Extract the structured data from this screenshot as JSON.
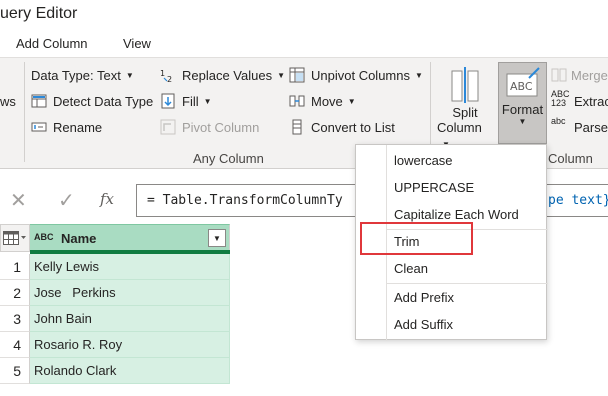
{
  "window": {
    "title": "uery Editor"
  },
  "ribbon_tabs": [
    "Add Column",
    "View"
  ],
  "ribbon": {
    "left_cut_label": "ws",
    "data_type": "Data Type: Text",
    "detect_data_type": "Detect Data Type",
    "rename": "Rename",
    "replace_values": "Replace Values",
    "fill": "Fill",
    "pivot_column": "Pivot Column",
    "unpivot_columns": "Unpivot Columns",
    "move": "Move",
    "convert_to_list": "Convert to List",
    "group_any_column": "Any Column",
    "split_column": "Split",
    "split_column_2": "Column",
    "format": "Format",
    "merge": "Merge",
    "extract": "Extrac",
    "parse": "Parse",
    "group_text_column": "Column",
    "format_icon_text": "ABC",
    "extract_icon_text": "ABC",
    "extract_icon_num": "123",
    "parse_icon_text": "abc"
  },
  "formula_bar": {
    "cancel_glyph": "✕",
    "confirm_glyph": "✓",
    "fx_label": "fx",
    "formula": "= Table.TransformColumnTy",
    "formula_tail": "pe text}"
  },
  "grid": {
    "type_icon": "ABC",
    "column_header": "Name",
    "rows": [
      {
        "num": "1",
        "value": "Kelly Lewis"
      },
      {
        "num": "2",
        "value": "Jose   Perkins"
      },
      {
        "num": "3",
        "value": "John Bain"
      },
      {
        "num": "4",
        "value": "Rosario R. Roy"
      },
      {
        "num": "5",
        "value": "Rolando Clark"
      }
    ]
  },
  "format_menu": {
    "items": [
      "lowercase",
      "UPPERCASE",
      "Capitalize Each Word",
      "Trim",
      "Clean",
      "Add Prefix",
      "Add Suffix"
    ],
    "highlighted": "Trim",
    "highlight_color": "#e0373b"
  },
  "colors": {
    "selected_column": "#d7f0e3",
    "column_header": "#a9dcc2",
    "accent_green": "#107c41"
  }
}
